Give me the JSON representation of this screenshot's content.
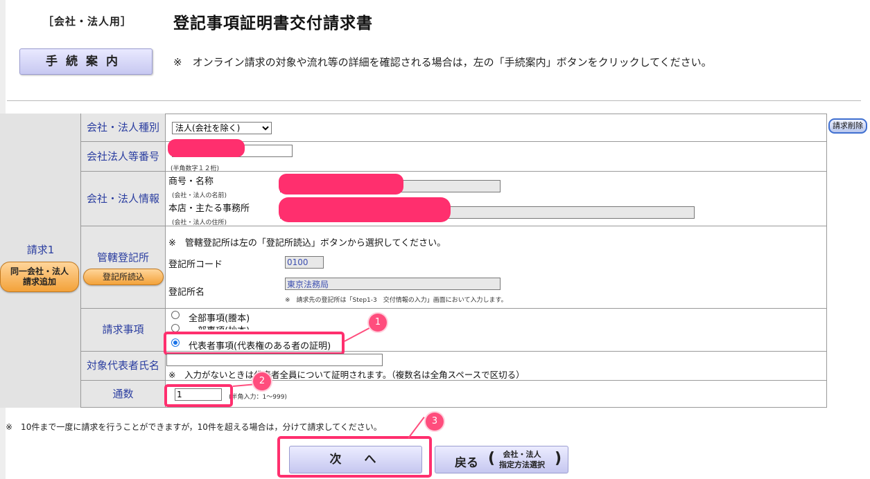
{
  "header": {
    "corp_tag": "［会社・法人用］",
    "title": "登記事項証明書交付請求書",
    "guide_button": "手続案内",
    "guide_note": "※　オンライン請求の対象や流れ等の詳細を確認される場合は，左の「手続案内」ボタンをクリックしてください。"
  },
  "request": {
    "label": "請求1",
    "add_button": "同一会社・法人\n請求追加",
    "delete_button": "請求削除"
  },
  "fields": {
    "kind_label": "会社・法人種別",
    "kind_value": "法人(会社を除く)",
    "number_label": "会社法人等番号",
    "number_hint": "(半角数字１２桁)",
    "info_label": "会社・法人情報",
    "name_label": "商号・名称",
    "name_hint": "(会社・法人の名前)",
    "address_label": "本店・主たる事務所",
    "address_hint": "(会社・法人の住所)",
    "office_label": "管轄登記所",
    "office_read_button": "登記所読込",
    "office_note": "※　管轄登記所は左の「登記所読込」ボタンから選択してください。",
    "office_code_label": "登記所コード",
    "office_code_value": "0100",
    "office_name_label": "登記所名",
    "office_name_value": "東京法務局",
    "office_name_note": "※　請求先の登記所は「Step1-3　交付情報の入力」画面において入力します。",
    "items_label": "請求事項",
    "item_options": [
      "全部事項(謄本)",
      "一部事項(抄本)",
      "代表者事項(代表権のある者の証明)"
    ],
    "selected_item_index": 2,
    "rep_label": "対象代表者氏名",
    "rep_note": "※　入力がないときは代表者全員について証明されます。（複数名は全角スペースで区切る）",
    "copies_label": "通数",
    "copies_value": "1",
    "copies_hint": "(半角入力：1〜999)"
  },
  "footer": {
    "note": "※　10件まで一度に請求を行うことができますが，10件を超える場合は，分けて請求してください。",
    "next_button": "次　へ",
    "back_button": "戻る",
    "back_paren_open": "(",
    "back_paren_close": ")",
    "back_sub_line1": "会社・法人",
    "back_sub_line2": "指定方法選択"
  },
  "annotations": {
    "badges": [
      "1",
      "2",
      "3"
    ]
  },
  "colors": {
    "label_text": "#2b3ea0",
    "highlight": "#ff2f6e",
    "button_face": "#c6c7f0",
    "orange": "#f3a23a"
  }
}
